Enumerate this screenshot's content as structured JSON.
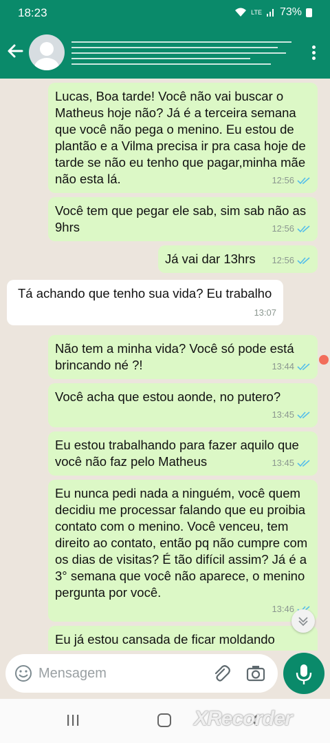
{
  "status": {
    "time": "18:23",
    "network": "LTE",
    "battery": "73%"
  },
  "messages": [
    {
      "direction": "out",
      "text": "Lucas, Boa tarde! Você não vai buscar o Matheus hoje não? Já é a terceira semana que você não pega o menino. Eu estou de plantão e a Vilma precisa ir pra casa hoje de tarde se não eu tenho que pagar,minha mãe não esta lá.",
      "time": "12:56"
    },
    {
      "direction": "out",
      "text": "Você tem que pegar ele sab, sim sab não as 9hrs",
      "time": "12:56"
    },
    {
      "direction": "out",
      "text": "Já vai dar 13hrs",
      "time": "12:56"
    },
    {
      "direction": "in",
      "text": "Tá achando que tenho sua vida? Eu trabalho",
      "time": "13:07"
    },
    {
      "direction": "out",
      "text": "Não tem a minha vida? Você só pode está brincando né ?!",
      "time": "13:44"
    },
    {
      "direction": "out",
      "text": "Você acha que estou aonde, no putero?",
      "time": "13:45"
    },
    {
      "direction": "out",
      "text": "Eu estou trabalhando para fazer aquilo que você não faz pelo Matheus",
      "time": "13:45"
    },
    {
      "direction": "out",
      "text": "Eu nunca pedi nada a ninguém, você quem decidiu me processar falando que eu proibia contato com o menino. Você venceu, tem direito ao contato, então pq não cumpre com os dias de visitas? É tão difícil assim? Já é a 3° semana que você não aparece, o menino pergunta por você.",
      "time": "13:46"
    },
    {
      "direction": "out",
      "text": "Eu já estou cansada de ficar moldando",
      "time": ""
    }
  ],
  "input": {
    "placeholder": "Mensagem"
  },
  "watermark": "XRecorder",
  "colors": {
    "header": "#0a8a6a",
    "outgoing": "#dcf8c6",
    "incoming": "#ffffff",
    "background": "#ece5dd",
    "read_ticks": "#53bdeb"
  }
}
